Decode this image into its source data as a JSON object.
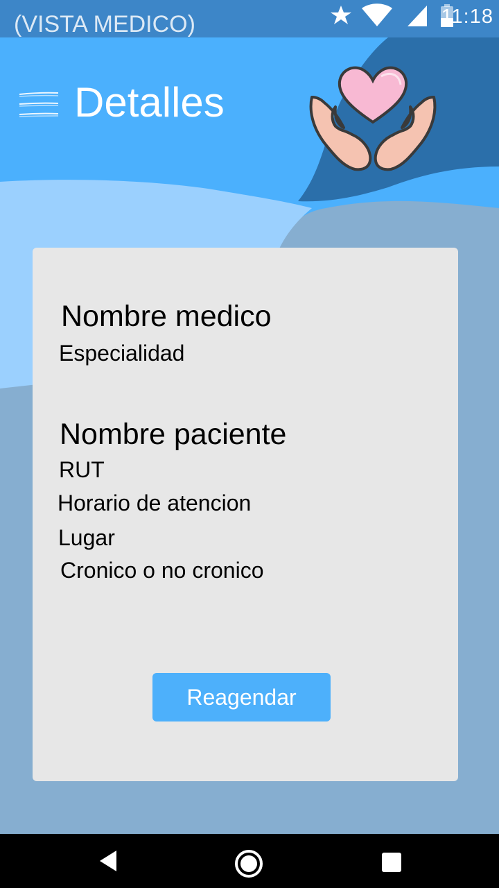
{
  "status_bar": {
    "view_label": "(VISTA MEDICO)",
    "time": "11:18",
    "icons": [
      "star-icon",
      "wifi-icon",
      "signal-icon",
      "battery-icon"
    ]
  },
  "header": {
    "title": "Detalles",
    "menu_icon": "hamburger-menu-icon",
    "logo_icon": "heart-in-hands-icon"
  },
  "card": {
    "doctor_name": "Nombre medico",
    "specialty": "Especialidad",
    "patient_name": "Nombre paciente",
    "rut": "RUT",
    "schedule": "Horario de atencion",
    "place": "Lugar",
    "chronic": "Cronico o no cronico",
    "reschedule_label": "Reagendar"
  },
  "nav_bar": {
    "icons": [
      "back-icon",
      "home-icon",
      "recent-apps-icon"
    ]
  },
  "colors": {
    "header_blue": "#4bb0fd",
    "dark_blue": "#2b6faa",
    "light_blue": "#9bd0fe",
    "body_blue": "#86aed0",
    "card_bg": "#e7e7e7",
    "button_blue": "#4db0fb"
  }
}
